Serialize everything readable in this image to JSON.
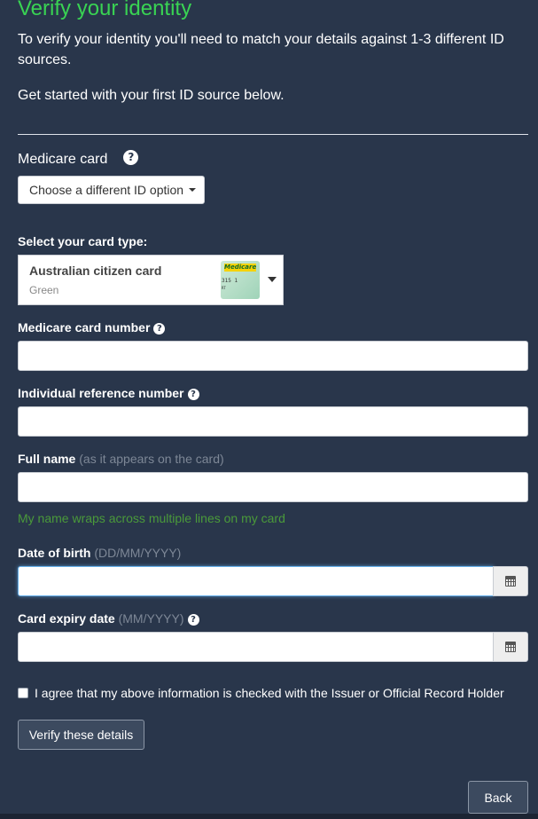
{
  "header": {
    "title": "Verify your identity",
    "intro": "To verify your identity you'll need to match your details against 1-3 different ID sources.",
    "intro2": "Get started with your first ID source below."
  },
  "id_source": {
    "label": "Medicare card",
    "help_glyph": "?",
    "dropdown_label": "Choose a different ID option"
  },
  "card_type": {
    "label": "Select your card type:",
    "selected_title": "Australian citizen card",
    "selected_subtitle": "Green",
    "thumb_brand": "Medicare",
    "thumb_number": "315 1",
    "thumb_small": "RT"
  },
  "form": {
    "medicare_number_label": "Medicare card number",
    "irn_label": "Individual reference number",
    "full_name_label": "Full name",
    "full_name_hint": "(as it appears on the card)",
    "wrap_link": "My name wraps across multiple lines on my card",
    "dob_label": "Date of birth",
    "dob_hint": "(DD/MM/YYYY)",
    "expiry_label": "Card expiry date",
    "expiry_hint": "(MM/YYYY)",
    "help_glyph": "?"
  },
  "consent": {
    "label": "I agree that my above information is checked with the Issuer or Official Record Holder",
    "checked": false
  },
  "actions": {
    "verify_label": "Verify these details",
    "back_label": "Back"
  },
  "colors": {
    "background": "#29364b",
    "title": "#39d353",
    "link": "#4a9a3a",
    "focus": "#66afe9"
  },
  "icons": {
    "help": "question-circle-icon",
    "calendar": "calendar-icon",
    "caret": "chevron-down-icon"
  }
}
